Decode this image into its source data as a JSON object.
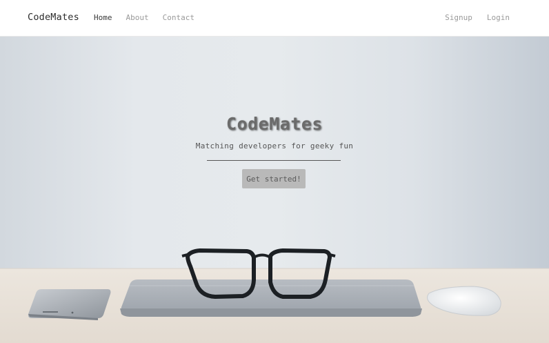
{
  "navbar": {
    "brand": "CodeMates",
    "left_links": [
      {
        "label": "Home",
        "active": true
      },
      {
        "label": "About",
        "active": false
      },
      {
        "label": "Contact",
        "active": false
      }
    ],
    "right_links": [
      {
        "label": "Signup"
      },
      {
        "label": "Login"
      }
    ]
  },
  "hero": {
    "title": "CodeMates",
    "subtitle": "Matching developers for geeky fun",
    "cta_label": "Get started!",
    "background_scene": [
      "smartphone",
      "laptop",
      "eyeglasses",
      "mouse"
    ]
  },
  "colors": {
    "navbar_bg": "#ffffff",
    "hero_wall": "#e3e7eb",
    "desk": "#eae4dc",
    "cta_bg": "#b9b9b9"
  }
}
